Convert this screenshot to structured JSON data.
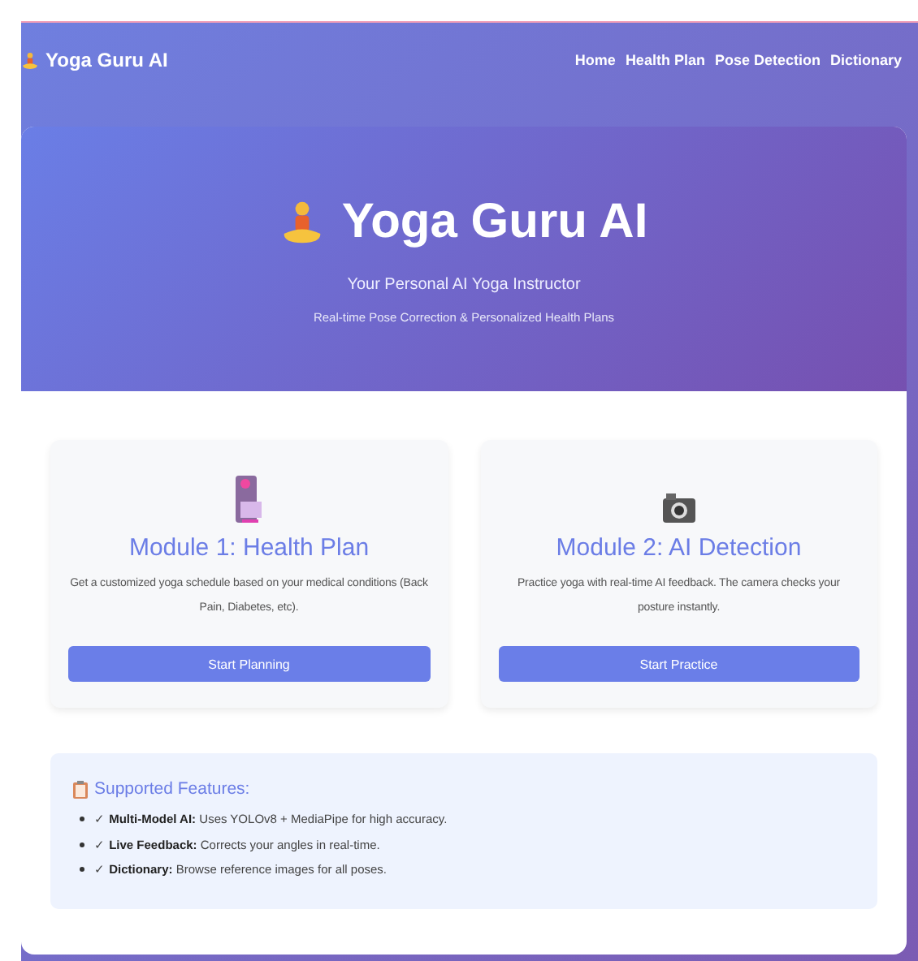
{
  "navbar": {
    "brand": "Yoga Guru AI",
    "links": [
      {
        "label": "Home"
      },
      {
        "label": "Health Plan"
      },
      {
        "label": "Pose Detection"
      },
      {
        "label": "Dictionary"
      }
    ]
  },
  "hero": {
    "title": "Yoga Guru AI",
    "subtitle": "Your Personal AI Yoga Instructor",
    "tagline": "Real-time Pose Correction & Personalized Health Plans"
  },
  "modules": [
    {
      "kind": "plan",
      "title": "Module 1: Health Plan",
      "description": "Get a customized yoga schedule based on your medical conditions (Back Pain, Diabetes, etc).",
      "button": "Start Planning"
    },
    {
      "kind": "camera",
      "title": "Module 2: AI Detection",
      "description": "Practice yoga with real-time AI feedback. The camera checks your posture instantly.",
      "button": "Start Practice"
    }
  ],
  "features": {
    "title": "Supported Features:",
    "items": [
      "✓ **Multi-Model AI:** Uses YOLOv8 + MediaPipe for high accuracy.",
      "✓ **Live Feedback:** Corrects your angles in real-time.",
      "✓ **Dictionary:** Browse reference images for all poses."
    ]
  }
}
